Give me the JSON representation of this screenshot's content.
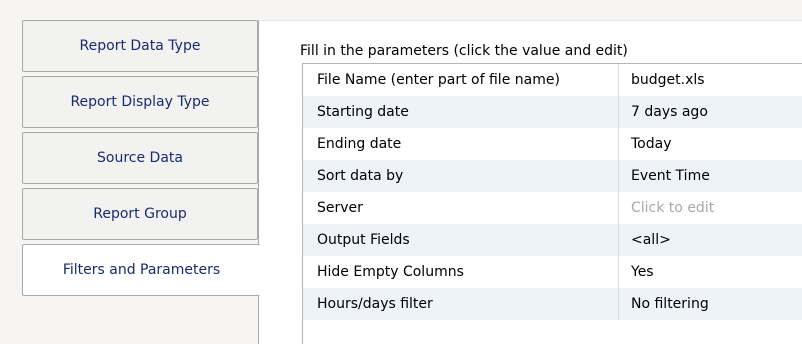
{
  "tabs": [
    {
      "label": "Report Data Type",
      "active": false
    },
    {
      "label": "Report Display Type",
      "active": false
    },
    {
      "label": "Source Data",
      "active": false
    },
    {
      "label": "Report Group",
      "active": false
    },
    {
      "label": "Filters and Parameters",
      "active": true
    }
  ],
  "panel": {
    "instructions": "Fill in the parameters (click the value and edit)",
    "params": [
      {
        "name": "File Name (enter part of file name)",
        "value": "budget.xls"
      },
      {
        "name": "Starting date",
        "value": "7 days ago"
      },
      {
        "name": "Ending date",
        "value": "Today"
      },
      {
        "name": "Sort data by",
        "value": "Event Time"
      },
      {
        "name": "Server",
        "value": "Click to edit"
      },
      {
        "name": "Output Fields",
        "value": "<all>"
      },
      {
        "name": "Hide Empty Columns",
        "value": "Yes"
      },
      {
        "name": "Hours/days filter",
        "value": "No filtering"
      }
    ]
  },
  "colors": {
    "tab_text": "#1a2a6e",
    "alt_row": "#eef2f9",
    "placeholder": "#a8a8a8"
  }
}
